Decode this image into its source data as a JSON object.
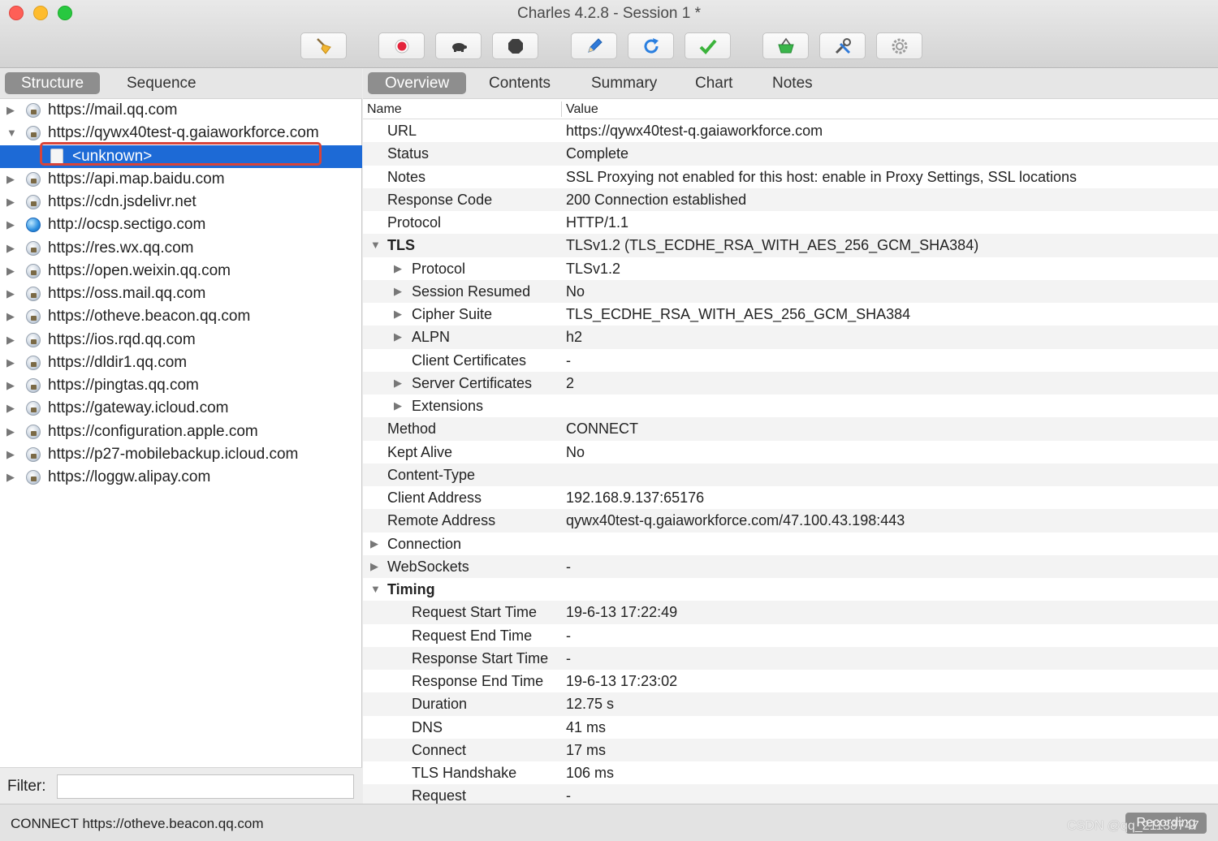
{
  "window": {
    "title": "Charles 4.2.8 - Session 1 *"
  },
  "toolbar": {
    "buttons": [
      {
        "icon": "broom-icon"
      },
      {
        "icon": "record-icon"
      },
      {
        "icon": "throttle-turtle-icon"
      },
      {
        "icon": "breakpoint-stop-icon"
      },
      {
        "icon": "compose-pen-icon"
      },
      {
        "icon": "repeat-refresh-icon"
      },
      {
        "icon": "validate-check-icon"
      },
      {
        "icon": "shopping-basket-icon"
      },
      {
        "icon": "tools-icon"
      },
      {
        "icon": "settings-gear-icon"
      }
    ]
  },
  "left": {
    "tabs": [
      "Structure",
      "Sequence"
    ],
    "active_tab": "Structure",
    "tree": [
      {
        "label": "https://mail.qq.com",
        "expanded": false,
        "icon": "lock-host-icon"
      },
      {
        "label": "https://qywx40test-q.gaiaworkforce.com",
        "expanded": true,
        "icon": "lock-host-icon"
      },
      {
        "label": "<unknown>",
        "child": true,
        "selected": true,
        "icon": "document-icon"
      },
      {
        "label": "https://api.map.baidu.com",
        "expanded": false,
        "icon": "lock-host-icon"
      },
      {
        "label": "https://cdn.jsdelivr.net",
        "expanded": false,
        "icon": "lock-host-icon"
      },
      {
        "label": "http://ocsp.sectigo.com",
        "expanded": false,
        "icon": "globe-icon"
      },
      {
        "label": "https://res.wx.qq.com",
        "expanded": false,
        "icon": "lock-host-icon"
      },
      {
        "label": "https://open.weixin.qq.com",
        "expanded": false,
        "icon": "lock-host-icon"
      },
      {
        "label": "https://oss.mail.qq.com",
        "expanded": false,
        "icon": "lock-host-icon"
      },
      {
        "label": "https://otheve.beacon.qq.com",
        "expanded": false,
        "icon": "lock-host-icon"
      },
      {
        "label": "https://ios.rqd.qq.com",
        "expanded": false,
        "icon": "lock-host-icon"
      },
      {
        "label": "https://dldir1.qq.com",
        "expanded": false,
        "icon": "lock-host-icon"
      },
      {
        "label": "https://pingtas.qq.com",
        "expanded": false,
        "icon": "lock-host-icon"
      },
      {
        "label": "https://gateway.icloud.com",
        "expanded": false,
        "icon": "lock-host-icon"
      },
      {
        "label": "https://configuration.apple.com",
        "expanded": false,
        "icon": "lock-host-icon"
      },
      {
        "label": "https://p27-mobilebackup.icloud.com",
        "expanded": false,
        "icon": "lock-host-icon"
      },
      {
        "label": "https://loggw.alipay.com",
        "expanded": false,
        "icon": "lock-host-icon"
      }
    ],
    "filter": {
      "label": "Filter:",
      "value": ""
    }
  },
  "right": {
    "tabs": [
      "Overview",
      "Contents",
      "Summary",
      "Chart",
      "Notes"
    ],
    "active_tab": "Overview",
    "columns": {
      "name": "Name",
      "value": "Value"
    },
    "rows": [
      {
        "name": "URL",
        "value": "https://qywx40test-q.gaiaworkforce.com",
        "level": 0
      },
      {
        "name": "Status",
        "value": "Complete",
        "level": 0
      },
      {
        "name": "Notes",
        "value": "SSL Proxying not enabled for this host: enable in Proxy Settings, SSL locations",
        "level": 0
      },
      {
        "name": "Response Code",
        "value": "200 Connection established",
        "level": 0
      },
      {
        "name": "Protocol",
        "value": "HTTP/1.1",
        "level": 0
      },
      {
        "name": "TLS",
        "value": "TLSv1.2 (TLS_ECDHE_RSA_WITH_AES_256_GCM_SHA384)",
        "level": 0,
        "toggle": "open",
        "bold": true
      },
      {
        "name": "Protocol",
        "value": "TLSv1.2",
        "level": 1,
        "toggle": "closed"
      },
      {
        "name": "Session Resumed",
        "value": "No",
        "level": 1,
        "toggle": "closed"
      },
      {
        "name": "Cipher Suite",
        "value": "TLS_ECDHE_RSA_WITH_AES_256_GCM_SHA384",
        "level": 1,
        "toggle": "closed"
      },
      {
        "name": "ALPN",
        "value": "h2",
        "level": 1,
        "toggle": "closed"
      },
      {
        "name": "Client Certificates",
        "value": "-",
        "level": 1
      },
      {
        "name": "Server Certificates",
        "value": "2",
        "level": 1,
        "toggle": "closed"
      },
      {
        "name": "Extensions",
        "value": "",
        "level": 1,
        "toggle": "closed"
      },
      {
        "name": "Method",
        "value": "CONNECT",
        "level": 0
      },
      {
        "name": "Kept Alive",
        "value": "No",
        "level": 0
      },
      {
        "name": "Content-Type",
        "value": "",
        "level": 0
      },
      {
        "name": "Client Address",
        "value": "192.168.9.137:65176",
        "level": 0
      },
      {
        "name": "Remote Address",
        "value": "qywx40test-q.gaiaworkforce.com/47.100.43.198:443",
        "level": 0
      },
      {
        "name": "Connection",
        "value": "",
        "level": 0,
        "toggle": "closed"
      },
      {
        "name": "WebSockets",
        "value": "-",
        "level": 0,
        "toggle": "closed"
      },
      {
        "name": "Timing",
        "value": "",
        "level": 0,
        "toggle": "open",
        "bold": true
      },
      {
        "name": "Request Start Time",
        "value": "19-6-13 17:22:49",
        "level": 1
      },
      {
        "name": "Request End Time",
        "value": "-",
        "level": 1
      },
      {
        "name": "Response Start Time",
        "value": "-",
        "level": 1
      },
      {
        "name": "Response End Time",
        "value": "19-6-13 17:23:02",
        "level": 1
      },
      {
        "name": "Duration",
        "value": "12.75 s",
        "level": 1
      },
      {
        "name": "DNS",
        "value": "41 ms",
        "level": 1
      },
      {
        "name": "Connect",
        "value": "17 ms",
        "level": 1
      },
      {
        "name": "TLS Handshake",
        "value": "106 ms",
        "level": 1
      },
      {
        "name": "Request",
        "value": "-",
        "level": 1
      }
    ]
  },
  "status": {
    "text": "CONNECT https://otheve.beacon.qq.com",
    "recording_label": "Recording",
    "watermark": "CSDN @qq_21138747"
  }
}
